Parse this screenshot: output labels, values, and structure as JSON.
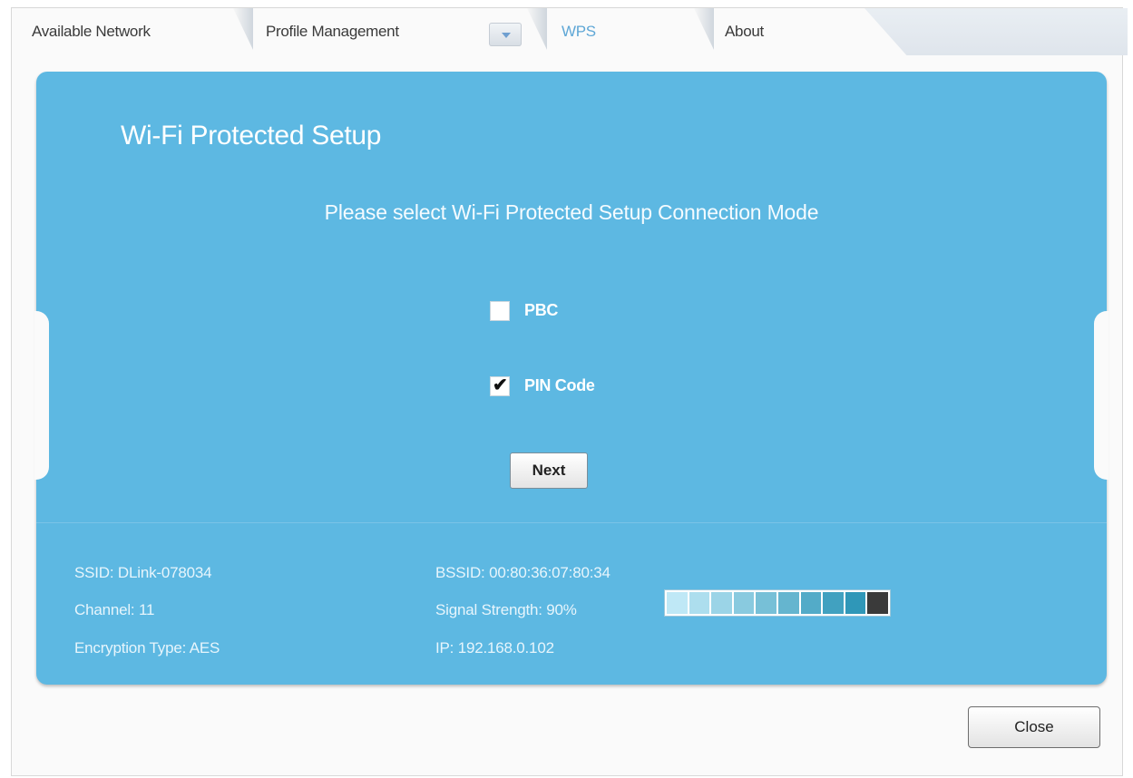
{
  "tabs": [
    {
      "label": "Available Network",
      "active": false
    },
    {
      "label": "Profile Management",
      "active": false
    },
    {
      "label": "WPS",
      "active": true
    },
    {
      "label": "About",
      "active": false
    }
  ],
  "panel": {
    "title": "Wi-Fi Protected Setup",
    "subtitle": "Please select Wi-Fi Protected Setup Connection Mode",
    "options": [
      {
        "label": "PBC",
        "checked": false
      },
      {
        "label": "PIN Code",
        "checked": true
      }
    ],
    "next_label": "Next"
  },
  "status": {
    "ssid": "SSID: DLink-078034",
    "channel": "Channel: 11",
    "encryption": "Encryption Type: AES",
    "bssid": "BSSID: 00:80:36:07:80:34",
    "signal": "Signal Strength: 90%",
    "signal_percent": 90,
    "ip": "IP: 192.168.0.102"
  },
  "colors": {
    "panel_bg": "#5db8e2",
    "active_tab": "#5fa7d6",
    "signal_light": "#bfe8f6",
    "signal_dark": "#2f97b8",
    "signal_end": "#3a3a3a"
  },
  "footer": {
    "close_label": "Close"
  },
  "icons": {
    "checkmark": "checkmark-icon",
    "dropdown": "chevron-down-icon"
  }
}
